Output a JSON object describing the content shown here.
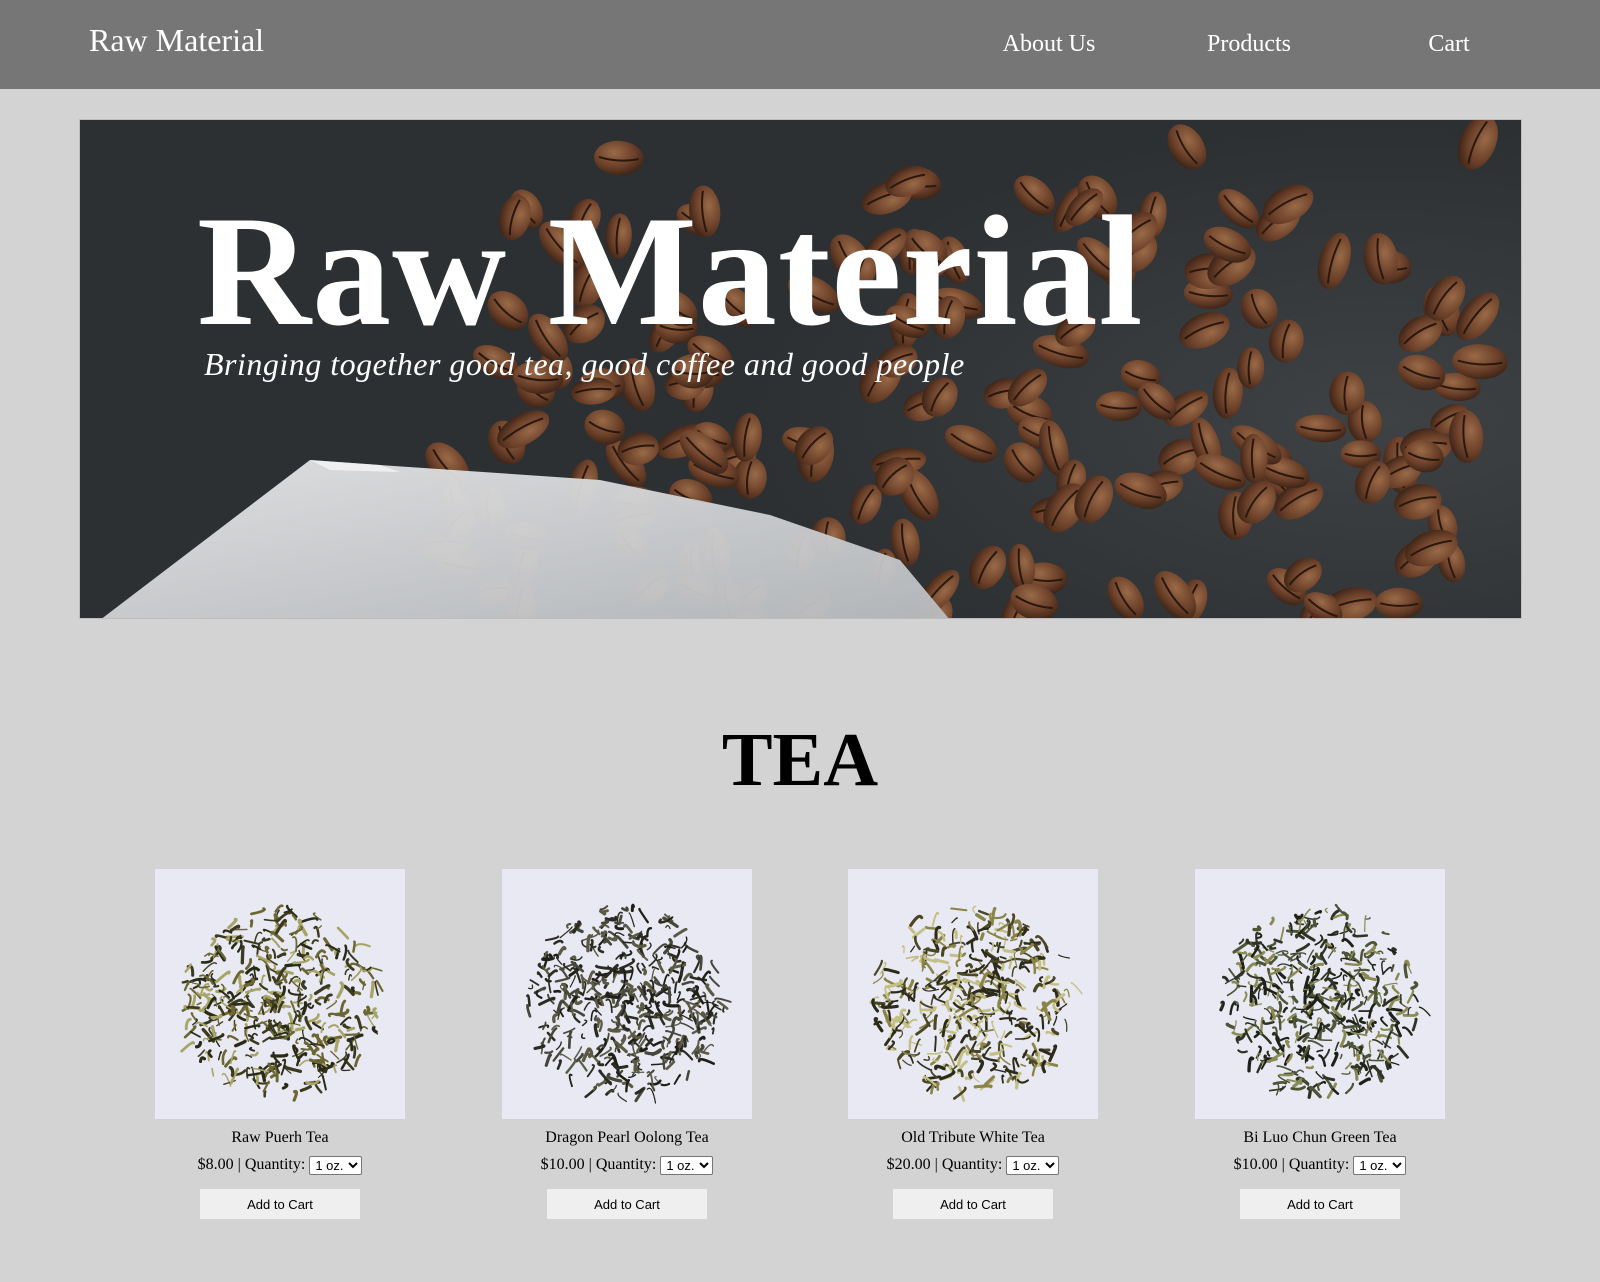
{
  "nav": {
    "brand": "Raw Material",
    "links": [
      "About Us",
      "Products",
      "Cart"
    ]
  },
  "hero": {
    "title": "Raw Material",
    "subtitle": "Bringing together good tea, good coffee and good people"
  },
  "section": {
    "title": "TEA"
  },
  "products": [
    {
      "name": "Raw Puerh Tea",
      "price": "$8.00",
      "qty_label": "Quantity:",
      "qty_value": "1 oz.",
      "button": "Add to Cart",
      "image": "loose-leaf-tea-photo"
    },
    {
      "name": "Dragon Pearl Oolong Tea",
      "price": "$10.00",
      "qty_label": "Quantity:",
      "qty_value": "1 oz.",
      "button": "Add to Cart",
      "image": "loose-leaf-tea-photo"
    },
    {
      "name": "Old Tribute White Tea",
      "price": "$20.00",
      "qty_label": "Quantity:",
      "qty_value": "1 oz.",
      "button": "Add to Cart",
      "image": "loose-leaf-tea-photo"
    },
    {
      "name": "Bi Luo Chun Green Tea",
      "price": "$10.00",
      "qty_label": "Quantity:",
      "qty_value": "1 oz.",
      "button": "Add to Cart",
      "image": "loose-leaf-tea-photo"
    }
  ],
  "colors": {
    "nav_bg": "#777677",
    "page_bg": "#d3d3d3",
    "button_bg": "#efefef"
  }
}
